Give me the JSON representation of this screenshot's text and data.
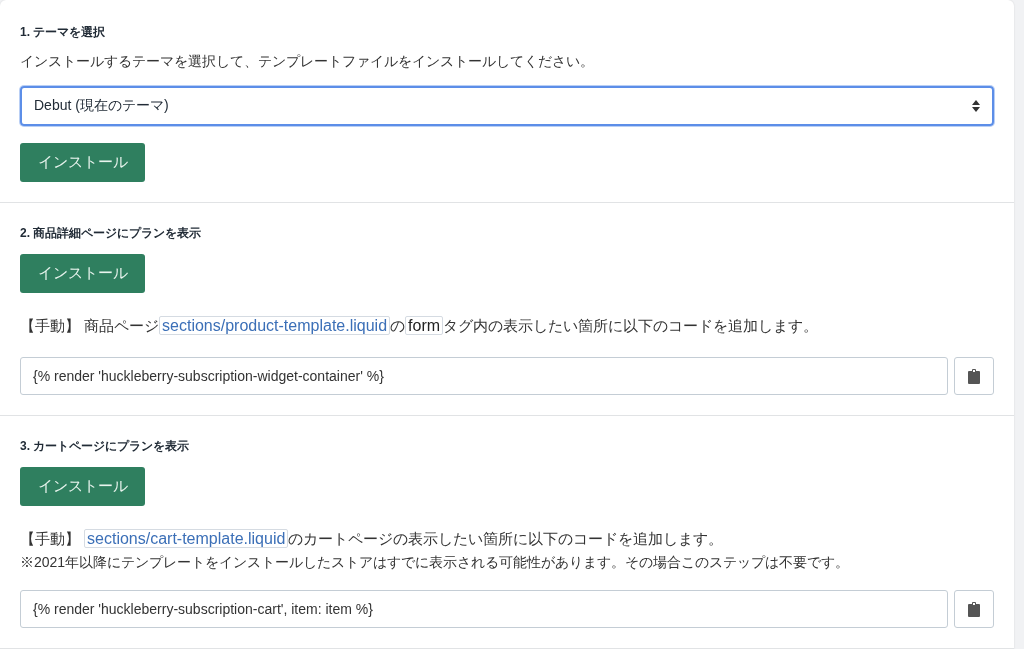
{
  "sections": [
    {
      "title": "1. テーマを選択",
      "description": "インストールするテーマを選択して、テンプレートファイルをインストールしてください。",
      "select": {
        "value": "Debut (現在のテーマ)",
        "focused": true
      },
      "install_button": "インストール"
    },
    {
      "title": "2. 商品詳細ページにプランを表示",
      "install_button": "インストール",
      "instruction": [
        {
          "kind": "text",
          "text": "【手動】 商品ページ"
        },
        {
          "kind": "path",
          "text": "sections/product-template.liquid"
        },
        {
          "kind": "text",
          "text": "の"
        },
        {
          "kind": "code",
          "text": "form"
        },
        {
          "kind": "text",
          "text": "タグ内の表示したい箇所に以下のコードを追加します。"
        }
      ],
      "code_field": {
        "value": "{% render 'huckleberry-subscription-widget-container' %}"
      }
    },
    {
      "title": "3. カートページにプランを表示",
      "install_button": "インストール",
      "instruction": [
        {
          "kind": "text",
          "text": "【手動】 "
        },
        {
          "kind": "path",
          "text": "sections/cart-template.liquid"
        },
        {
          "kind": "text",
          "text": "のカートページの表示したい箇所に以下のコードを追加します。"
        }
      ],
      "note": "※2021年以降にテンプレートをインストールしたストアはすでに表示される可能性があります。その場合このステップは不要です。",
      "code_field": {
        "value": "{% render 'huckleberry-subscription-cart', item: item %}"
      }
    }
  ]
}
